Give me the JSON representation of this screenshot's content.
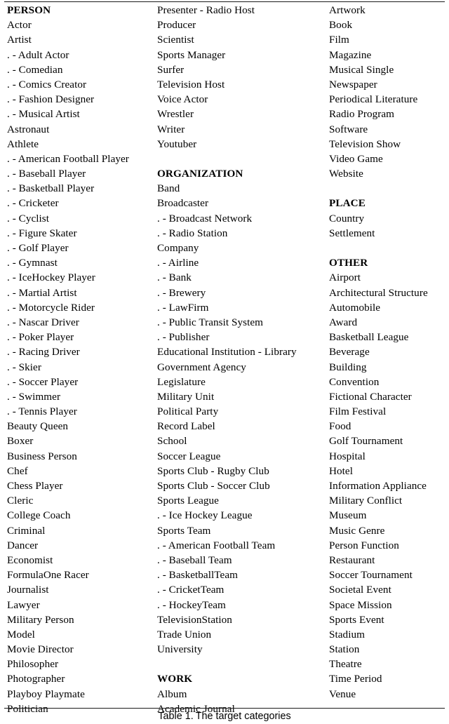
{
  "document": {
    "caption_label": "Table 1.",
    "caption_text": "The target categories",
    "rule_color": "#1a1a1a",
    "text_color": "#000000",
    "background": "#ffffff"
  },
  "table": {
    "columns": [
      {
        "id": "column-1",
        "entries": [
          {
            "text": "PERSON",
            "style": "head"
          },
          {
            "text": "Actor",
            "style": "item"
          },
          {
            "text": "Artist",
            "style": "item"
          },
          {
            "text": ". - Adult Actor",
            "style": "item"
          },
          {
            "text": ". - Comedian",
            "style": "item"
          },
          {
            "text": ". - Comics Creator",
            "style": "item"
          },
          {
            "text": ". - Fashion Designer",
            "style": "item"
          },
          {
            "text": ". - Musical Artist",
            "style": "item"
          },
          {
            "text": "Astronaut",
            "style": "item"
          },
          {
            "text": "Athlete",
            "style": "item"
          },
          {
            "text": ". - American Football Player",
            "style": "item"
          },
          {
            "text": ". - Baseball Player",
            "style": "item"
          },
          {
            "text": ". - Basketball Player",
            "style": "item"
          },
          {
            "text": ". - Cricketer",
            "style": "item"
          },
          {
            "text": ". - Cyclist",
            "style": "item"
          },
          {
            "text": ". - Figure Skater",
            "style": "item"
          },
          {
            "text": ". - Golf Player",
            "style": "item"
          },
          {
            "text": ". - Gymnast",
            "style": "item"
          },
          {
            "text": ". - IceHockey Player",
            "style": "item"
          },
          {
            "text": ". - Martial Artist",
            "style": "item"
          },
          {
            "text": ". - Motorcycle Rider",
            "style": "item"
          },
          {
            "text": ". - Nascar Driver",
            "style": "item"
          },
          {
            "text": ". - Poker Player",
            "style": "item"
          },
          {
            "text": ". - Racing Driver",
            "style": "item"
          },
          {
            "text": ". - Skier",
            "style": "item"
          },
          {
            "text": ". - Soccer Player",
            "style": "item"
          },
          {
            "text": ". - Swimmer",
            "style": "item"
          },
          {
            "text": ". - Tennis Player",
            "style": "item"
          },
          {
            "text": "Beauty Queen",
            "style": "item"
          },
          {
            "text": "Boxer",
            "style": "item"
          },
          {
            "text": "Business Person",
            "style": "item"
          },
          {
            "text": "Chef",
            "style": "item"
          },
          {
            "text": "Chess Player",
            "style": "item"
          },
          {
            "text": "Cleric",
            "style": "item"
          },
          {
            "text": "College Coach",
            "style": "item"
          },
          {
            "text": "Criminal",
            "style": "item"
          },
          {
            "text": "Dancer",
            "style": "item"
          },
          {
            "text": "Economist",
            "style": "item"
          },
          {
            "text": "FormulaOne Racer",
            "style": "item"
          },
          {
            "text": "Journalist",
            "style": "item"
          },
          {
            "text": "Lawyer",
            "style": "item"
          },
          {
            "text": "Military Person",
            "style": "item"
          },
          {
            "text": "Model",
            "style": "item"
          },
          {
            "text": "Movie Director",
            "style": "item"
          },
          {
            "text": "Philosopher",
            "style": "item"
          },
          {
            "text": "Photographer",
            "style": "item"
          },
          {
            "text": "Playboy Playmate",
            "style": "item"
          },
          {
            "text": "Politician",
            "style": "item"
          }
        ]
      },
      {
        "id": "column-2",
        "entries": [
          {
            "text": "Presenter - Radio Host",
            "style": "item"
          },
          {
            "text": "Producer",
            "style": "item"
          },
          {
            "text": "Scientist",
            "style": "item"
          },
          {
            "text": "Sports Manager",
            "style": "item"
          },
          {
            "text": "Surfer",
            "style": "item"
          },
          {
            "text": "Television Host",
            "style": "item"
          },
          {
            "text": "Voice Actor",
            "style": "item"
          },
          {
            "text": "Wrestler",
            "style": "item"
          },
          {
            "text": "Writer",
            "style": "item"
          },
          {
            "text": "Youtuber",
            "style": "item"
          },
          {
            "text": "",
            "style": "spacer"
          },
          {
            "text": "ORGANIZATION",
            "style": "head"
          },
          {
            "text": "Band",
            "style": "item"
          },
          {
            "text": "Broadcaster",
            "style": "item"
          },
          {
            "text": ". - Broadcast Network",
            "style": "item"
          },
          {
            "text": ". - Radio Station",
            "style": "item"
          },
          {
            "text": "Company",
            "style": "item"
          },
          {
            "text": ". - Airline",
            "style": "item"
          },
          {
            "text": ". - Bank",
            "style": "item"
          },
          {
            "text": ". - Brewery",
            "style": "item"
          },
          {
            "text": ". - LawFirm",
            "style": "item"
          },
          {
            "text": ". - Public Transit System",
            "style": "item"
          },
          {
            "text": ". - Publisher",
            "style": "item"
          },
          {
            "text": "Educational Institution - Library",
            "style": "item"
          },
          {
            "text": "Government Agency",
            "style": "item"
          },
          {
            "text": "Legislature",
            "style": "item"
          },
          {
            "text": "Military Unit",
            "style": "item"
          },
          {
            "text": "Political Party",
            "style": "item"
          },
          {
            "text": "Record Label",
            "style": "item"
          },
          {
            "text": "School",
            "style": "item"
          },
          {
            "text": "Soccer League",
            "style": "item"
          },
          {
            "text": "Sports Club - Rugby Club",
            "style": "item"
          },
          {
            "text": "Sports Club - Soccer Club",
            "style": "item"
          },
          {
            "text": "Sports League",
            "style": "item"
          },
          {
            "text": ". - Ice Hockey League",
            "style": "item"
          },
          {
            "text": "Sports Team",
            "style": "item"
          },
          {
            "text": ". - American Football Team",
            "style": "item"
          },
          {
            "text": ". - Baseball Team",
            "style": "item"
          },
          {
            "text": ". - BasketballTeam",
            "style": "item"
          },
          {
            "text": ". - CricketTeam",
            "style": "item"
          },
          {
            "text": ". - HockeyTeam",
            "style": "item"
          },
          {
            "text": "TelevisionStation",
            "style": "item"
          },
          {
            "text": "Trade Union",
            "style": "item"
          },
          {
            "text": "University",
            "style": "item"
          },
          {
            "text": "",
            "style": "spacer"
          },
          {
            "text": "WORK",
            "style": "head"
          },
          {
            "text": "Album",
            "style": "item"
          },
          {
            "text": "Academic Journal",
            "style": "item"
          }
        ]
      },
      {
        "id": "column-3",
        "entries": [
          {
            "text": "Artwork",
            "style": "item"
          },
          {
            "text": "Book",
            "style": "item"
          },
          {
            "text": "Film",
            "style": "item"
          },
          {
            "text": "Magazine",
            "style": "item"
          },
          {
            "text": "Musical Single",
            "style": "item"
          },
          {
            "text": "Newspaper",
            "style": "item"
          },
          {
            "text": "Periodical Literature",
            "style": "item"
          },
          {
            "text": "Radio Program",
            "style": "item"
          },
          {
            "text": "Software",
            "style": "item"
          },
          {
            "text": "Television Show",
            "style": "item"
          },
          {
            "text": "Video Game",
            "style": "item"
          },
          {
            "text": "Website",
            "style": "item"
          },
          {
            "text": "",
            "style": "spacer"
          },
          {
            "text": "PLACE",
            "style": "head"
          },
          {
            "text": "Country",
            "style": "item"
          },
          {
            "text": "Settlement",
            "style": "item"
          },
          {
            "text": "",
            "style": "spacer"
          },
          {
            "text": "OTHER",
            "style": "head"
          },
          {
            "text": "Airport",
            "style": "item"
          },
          {
            "text": "Architectural Structure",
            "style": "item"
          },
          {
            "text": "Automobile",
            "style": "item"
          },
          {
            "text": "Award",
            "style": "item"
          },
          {
            "text": "Basketball League",
            "style": "item"
          },
          {
            "text": "Beverage",
            "style": "item"
          },
          {
            "text": "Building",
            "style": "item"
          },
          {
            "text": "Convention",
            "style": "item"
          },
          {
            "text": "Fictional Character",
            "style": "item"
          },
          {
            "text": "Film Festival",
            "style": "item"
          },
          {
            "text": "Food",
            "style": "item"
          },
          {
            "text": "Golf Tournament",
            "style": "item"
          },
          {
            "text": "Hospital",
            "style": "item"
          },
          {
            "text": "Hotel",
            "style": "item"
          },
          {
            "text": "Information Appliance",
            "style": "item"
          },
          {
            "text": "Military Conflict",
            "style": "item"
          },
          {
            "text": "Museum",
            "style": "item"
          },
          {
            "text": "Music Genre",
            "style": "item"
          },
          {
            "text": "Person Function",
            "style": "item"
          },
          {
            "text": "Restaurant",
            "style": "item"
          },
          {
            "text": "Soccer Tournament",
            "style": "item"
          },
          {
            "text": "Societal Event",
            "style": "item"
          },
          {
            "text": "Space Mission",
            "style": "item"
          },
          {
            "text": "Sports Event",
            "style": "item"
          },
          {
            "text": "Stadium",
            "style": "item"
          },
          {
            "text": "Station",
            "style": "item"
          },
          {
            "text": "Theatre",
            "style": "item"
          },
          {
            "text": "Time Period",
            "style": "item"
          },
          {
            "text": "Venue",
            "style": "item"
          }
        ]
      }
    ]
  }
}
